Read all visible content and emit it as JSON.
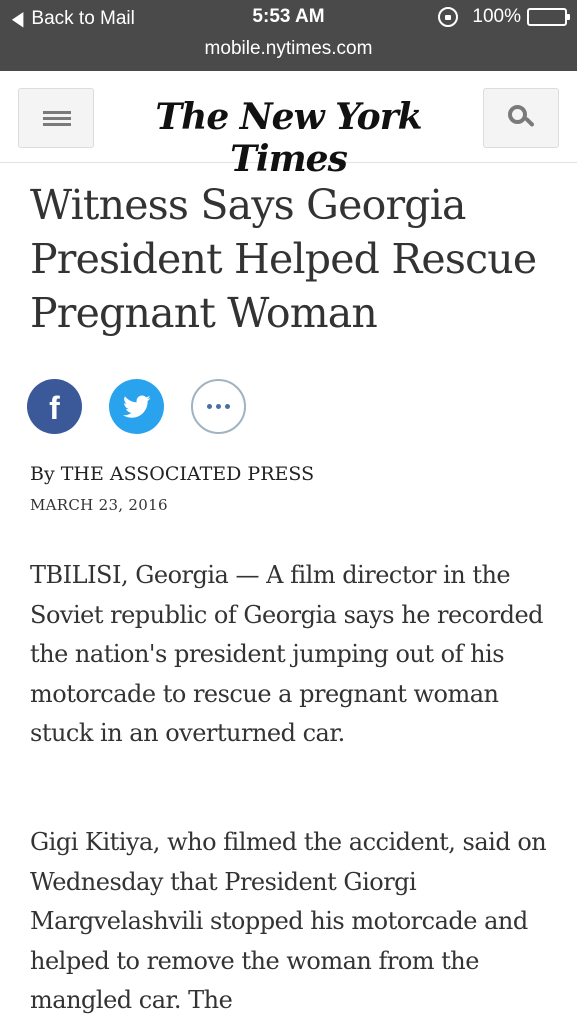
{
  "status_bar": {
    "back_label": "Back to Mail",
    "time": "5:53 AM",
    "battery": "100%",
    "url": "mobile.nytimes.com"
  },
  "header": {
    "logo_text": "The New York Times",
    "menu_icon": "hamburger-icon",
    "search_icon": "search-icon"
  },
  "article": {
    "headline": "Witness Says Georgia President Helped Rescue Pregnant Woman",
    "share": {
      "facebook_glyph": "f",
      "icons": [
        "facebook-icon",
        "twitter-icon",
        "more-icon"
      ]
    },
    "byline": "By THE ASSOCIATED PRESS",
    "date": "MARCH 23, 2016",
    "paragraphs": [
      "TBILISI, Georgia — A film director in the Soviet republic of Georgia says he recorded the nation's president jumping out of his motorcade to rescue a pregnant woman stuck in an overturned car.",
      "Gigi Kitiya, who filmed the accident, said on Wednesday that President Giorgi Margvelashvili stopped his motorcade and helped to remove the woman from the mangled car. The"
    ]
  },
  "colors": {
    "status_bar_bg": "#4a4a4a",
    "facebook": "#3b5998",
    "twitter": "#2aa3ef",
    "text": "#333333"
  }
}
